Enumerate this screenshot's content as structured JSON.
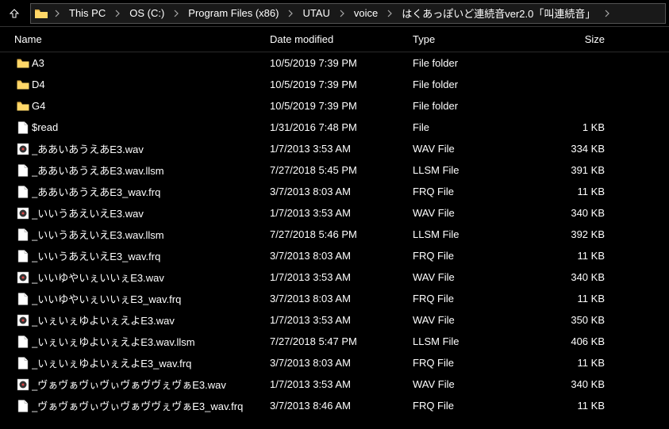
{
  "nav": {
    "breadcrumb": [
      "This PC",
      "OS (C:)",
      "Program Files (x86)",
      "UTAU",
      "voice",
      "はくあっぽいど連続音ver2.0「叫連続音」"
    ]
  },
  "columns": {
    "name": "Name",
    "date": "Date modified",
    "type": "Type",
    "size": "Size"
  },
  "files": [
    {
      "name": "A3",
      "date": "10/5/2019 7:39 PM",
      "type": "File folder",
      "size": "",
      "icon": "folder"
    },
    {
      "name": "D4",
      "date": "10/5/2019 7:39 PM",
      "type": "File folder",
      "size": "",
      "icon": "folder"
    },
    {
      "name": "G4",
      "date": "10/5/2019 7:39 PM",
      "type": "File folder",
      "size": "",
      "icon": "folder"
    },
    {
      "name": "$read",
      "date": "1/31/2016 7:48 PM",
      "type": "File",
      "size": "1 KB",
      "icon": "file"
    },
    {
      "name": "_ああいあうえあE3.wav",
      "date": "1/7/2013 3:53 AM",
      "type": "WAV File",
      "size": "334 KB",
      "icon": "wav"
    },
    {
      "name": "_ああいあうえあE3.wav.llsm",
      "date": "7/27/2018 5:45 PM",
      "type": "LLSM File",
      "size": "391 KB",
      "icon": "file"
    },
    {
      "name": "_ああいあうえあE3_wav.frq",
      "date": "3/7/2013 8:03 AM",
      "type": "FRQ File",
      "size": "11 KB",
      "icon": "file"
    },
    {
      "name": "_いいうあえいえE3.wav",
      "date": "1/7/2013 3:53 AM",
      "type": "WAV File",
      "size": "340 KB",
      "icon": "wav"
    },
    {
      "name": "_いいうあえいえE3.wav.llsm",
      "date": "7/27/2018 5:46 PM",
      "type": "LLSM File",
      "size": "392 KB",
      "icon": "file"
    },
    {
      "name": "_いいうあえいえE3_wav.frq",
      "date": "3/7/2013 8:03 AM",
      "type": "FRQ File",
      "size": "11 KB",
      "icon": "file"
    },
    {
      "name": "_いいゆやいぇいいぇE3.wav",
      "date": "1/7/2013 3:53 AM",
      "type": "WAV File",
      "size": "340 KB",
      "icon": "wav"
    },
    {
      "name": "_いいゆやいぇいいぇE3_wav.frq",
      "date": "3/7/2013 8:03 AM",
      "type": "FRQ File",
      "size": "11 KB",
      "icon": "file"
    },
    {
      "name": "_いぇいぇゆよいぇえよE3.wav",
      "date": "1/7/2013 3:53 AM",
      "type": "WAV File",
      "size": "350 KB",
      "icon": "wav"
    },
    {
      "name": "_いぇいぇゆよいぇえよE3.wav.llsm",
      "date": "7/27/2018 5:47 PM",
      "type": "LLSM File",
      "size": "406 KB",
      "icon": "file"
    },
    {
      "name": "_いぇいぇゆよいぇえよE3_wav.frq",
      "date": "3/7/2013 8:03 AM",
      "type": "FRQ File",
      "size": "11 KB",
      "icon": "file"
    },
    {
      "name": "_ヴぁヴぁヴぃヴぃヴぁヴヴぇヴぁE3.wav",
      "date": "1/7/2013 3:53 AM",
      "type": "WAV File",
      "size": "340 KB",
      "icon": "wav"
    },
    {
      "name": "_ヴぁヴぁヴぃヴぃヴぁヴヴぇヴぁE3_wav.frq",
      "date": "3/7/2013 8:46 AM",
      "type": "FRQ File",
      "size": "11 KB",
      "icon": "file"
    }
  ]
}
